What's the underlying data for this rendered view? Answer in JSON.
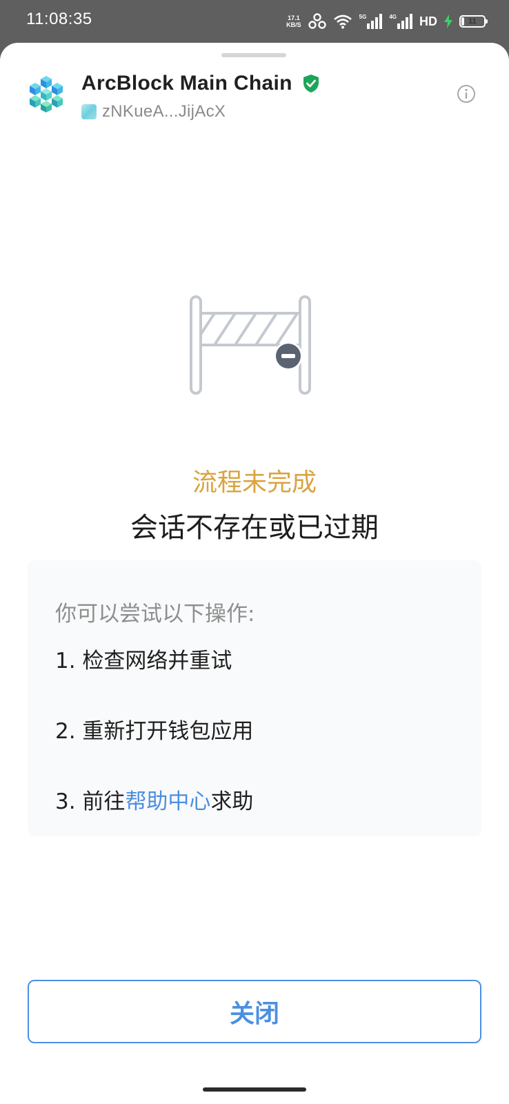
{
  "status_bar": {
    "time": "11:08:35",
    "net_speed_value": "17.1",
    "net_speed_unit": "KB/S",
    "sig1_tag": "5G",
    "sig2_tag": "4G",
    "hd_label": "HD",
    "battery_level": "11",
    "battery_percent": 11
  },
  "header": {
    "title": "ArcBlock Main Chain",
    "address": "zNKueA...JijAcX"
  },
  "main": {
    "status_title": "流程未完成",
    "message": "会话不存在或已过期",
    "suggestions_title": "你可以尝试以下操作:",
    "items": [
      {
        "text": "1. 检查网络并重试"
      },
      {
        "text": "2. 重新打开钱包应用"
      },
      {
        "prefix": "3. 前往",
        "link": "帮助中心",
        "suffix": "求助"
      }
    ]
  },
  "footer": {
    "close_label": "关闭"
  },
  "colors": {
    "accent": "#4a90e2",
    "warning": "#d9a33f",
    "verified": "#1ea55a"
  }
}
